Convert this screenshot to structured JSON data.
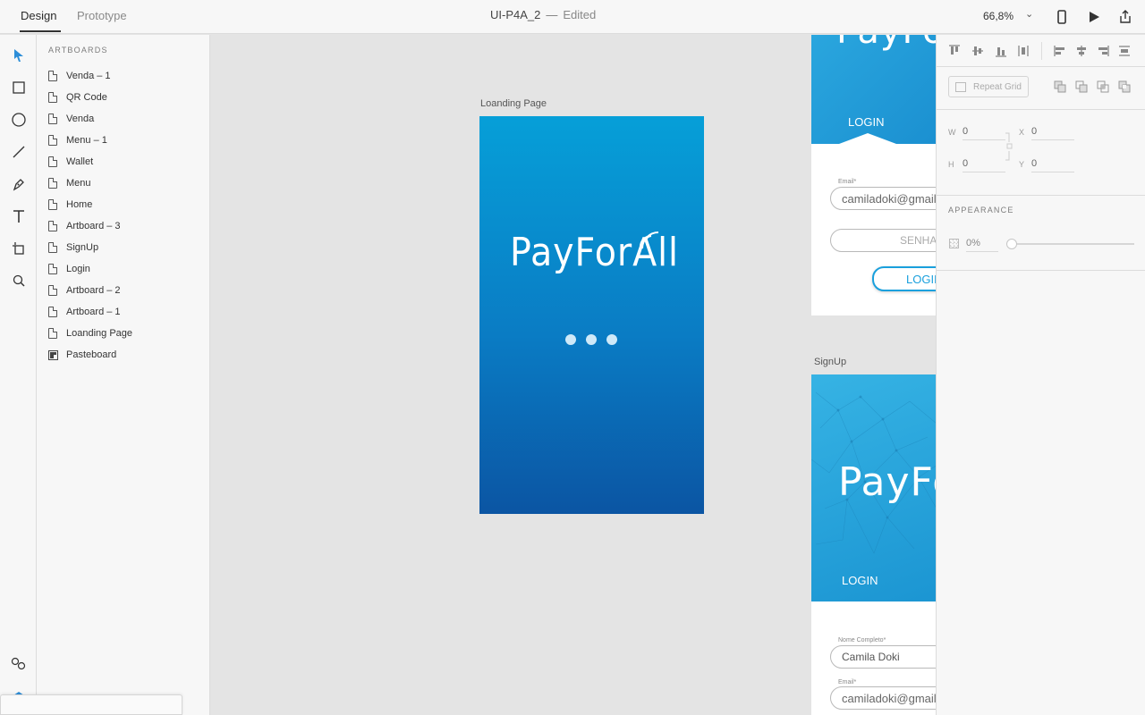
{
  "topbar": {
    "tabs": [
      {
        "label": "Design",
        "active": true
      },
      {
        "label": "Prototype",
        "active": false
      }
    ],
    "document_name": "UI-P4A_2",
    "status": "Edited",
    "zoom": "66,8%"
  },
  "toolrail": {
    "tools": [
      "select-icon",
      "rectangle-icon",
      "ellipse-icon",
      "line-icon",
      "pen-icon",
      "text-icon",
      "artboard-icon",
      "zoom-icon",
      "symbols-icon"
    ]
  },
  "layers": {
    "title": "ARTBOARDS",
    "items": [
      {
        "label": "Venda – 1",
        "icon": "artboard"
      },
      {
        "label": "QR Code",
        "icon": "artboard"
      },
      {
        "label": "Venda",
        "icon": "artboard"
      },
      {
        "label": "Menu – 1",
        "icon": "artboard"
      },
      {
        "label": "Wallet",
        "icon": "artboard"
      },
      {
        "label": "Menu",
        "icon": "artboard"
      },
      {
        "label": "Home",
        "icon": "artboard"
      },
      {
        "label": "Artboard – 3",
        "icon": "artboard"
      },
      {
        "label": "SignUp",
        "icon": "artboard"
      },
      {
        "label": "Login",
        "icon": "artboard"
      },
      {
        "label": "Artboard – 2",
        "icon": "artboard"
      },
      {
        "label": "Artboard – 1",
        "icon": "artboard"
      },
      {
        "label": "Loanding Page",
        "icon": "artboard"
      },
      {
        "label": "Pasteboard",
        "icon": "pasteboard"
      }
    ]
  },
  "canvas": {
    "loading_page": {
      "label": "Loanding Page",
      "logo_text": "PayForAll",
      "gradient_top": "#069fd8",
      "gradient_bottom": "#0b55a3"
    },
    "login_board": {
      "logo_fragment": "PayFo",
      "tab_label": "LOGIN",
      "email_label": "Email*",
      "email_value": "camiladoki@gmail.com",
      "password_placeholder": "SENHA",
      "login_button": "LOGIN"
    },
    "signup_board": {
      "label": "SignUp",
      "logo_fragment": "PayFo",
      "tab_label": "LOGIN",
      "name_label": "Nome Completo*",
      "name_value": "Camila Doki",
      "email_label": "Email*",
      "email_value": "camiladoki@gmail.com"
    }
  },
  "properties": {
    "repeat_grid_label": "Repeat Grid",
    "w_label": "W",
    "w_value": "0",
    "h_label": "H",
    "h_value": "0",
    "x_label": "X",
    "x_value": "0",
    "y_label": "Y",
    "y_value": "0",
    "appearance_title": "APPEARANCE",
    "opacity": "0%"
  },
  "colors": {
    "accent": "#1aa0dd",
    "selected_tool": "#2d8ed8"
  }
}
